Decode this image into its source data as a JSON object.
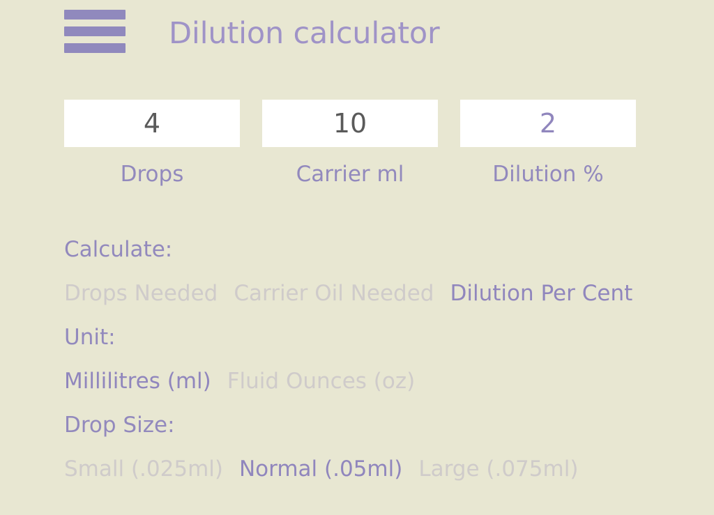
{
  "header": {
    "menu_icon": "hamburger-menu-icon",
    "title": "Dilution calculator"
  },
  "theme": {
    "background": "#e8e7d2",
    "accent_purple": "#9086bd",
    "title_purple": "#9f93c7",
    "muted": "#cfcbca",
    "input_text": "#5a5a5a",
    "field_background": "#ffffff"
  },
  "fields": [
    {
      "name": "drops",
      "value": "4",
      "label": "Drops",
      "readonly": false
    },
    {
      "name": "carrier_ml",
      "value": "10",
      "label": "Carrier ml",
      "readonly": false
    },
    {
      "name": "dilution_percent",
      "value": "2",
      "label": "Dilution %",
      "readonly": true
    }
  ],
  "groups": [
    {
      "key": "calculate",
      "heading": "Calculate:",
      "options": [
        {
          "label": "Drops Needed",
          "selected": false
        },
        {
          "label": "Carrier Oil Needed",
          "selected": false
        },
        {
          "label": "Dilution Per Cent",
          "selected": true
        }
      ]
    },
    {
      "key": "unit",
      "heading": "Unit:",
      "options": [
        {
          "label": "Millilitres (ml)",
          "selected": true
        },
        {
          "label": "Fluid Ounces (oz)",
          "selected": false
        }
      ]
    },
    {
      "key": "drop_size",
      "heading": "Drop Size:",
      "options": [
        {
          "label": "Small (.025ml)",
          "selected": false
        },
        {
          "label": "Normal (.05ml)",
          "selected": true
        },
        {
          "label": "Large (.075ml)",
          "selected": false
        }
      ]
    }
  ]
}
